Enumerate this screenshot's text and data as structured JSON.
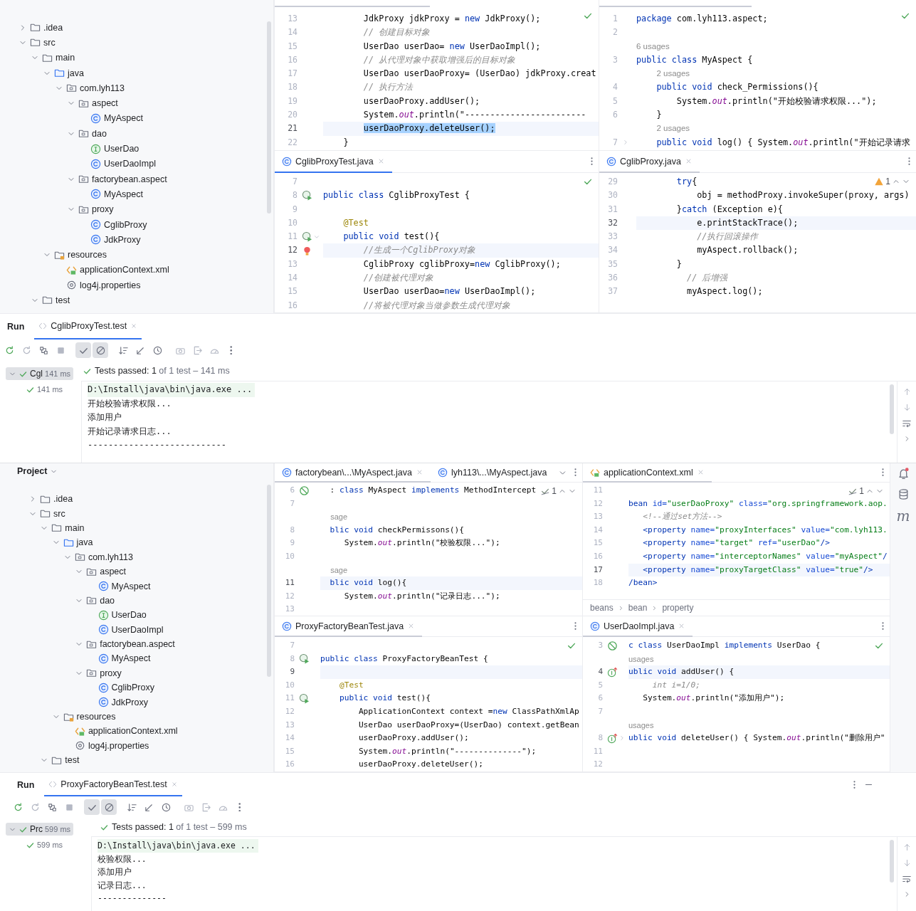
{
  "screens": [
    {
      "project": {
        "tree": [
          {
            "label": ".idea",
            "kind": "folder",
            "expanded": false
          },
          {
            "label": "src",
            "kind": "folder",
            "expanded": true,
            "children": [
              {
                "label": "main",
                "kind": "folder",
                "expanded": true,
                "children": [
                  {
                    "label": "java",
                    "kind": "source-folder",
                    "expanded": true,
                    "children": [
                      {
                        "label": "com.lyh113",
                        "kind": "package",
                        "expanded": true,
                        "children": [
                          {
                            "label": "aspect",
                            "kind": "package",
                            "expanded": true,
                            "children": [
                              {
                                "label": "MyAspect",
                                "kind": "class"
                              }
                            ]
                          },
                          {
                            "label": "dao",
                            "kind": "package",
                            "expanded": true,
                            "children": [
                              {
                                "label": "UserDao",
                                "kind": "interface"
                              },
                              {
                                "label": "UserDaoImpl",
                                "kind": "class"
                              }
                            ]
                          },
                          {
                            "label": "factorybean.aspect",
                            "kind": "package",
                            "expanded": true,
                            "children": [
                              {
                                "label": "MyAspect",
                                "kind": "class"
                              }
                            ]
                          },
                          {
                            "label": "proxy",
                            "kind": "package",
                            "expanded": true,
                            "children": [
                              {
                                "label": "CglibProxy",
                                "kind": "class"
                              },
                              {
                                "label": "JdkProxy",
                                "kind": "class"
                              }
                            ]
                          }
                        ]
                      }
                    ]
                  },
                  {
                    "label": "resources",
                    "kind": "resources",
                    "expanded": true,
                    "children": [
                      {
                        "label": "applicationContext.xml",
                        "kind": "xml"
                      },
                      {
                        "label": "log4j.properties",
                        "kind": "properties"
                      }
                    ]
                  }
                ]
              },
              {
                "label": "test",
                "kind": "folder",
                "expanded": true
              }
            ]
          }
        ]
      },
      "editors": [
        {
          "focused": false,
          "inspection": {
            "kind": "ok"
          },
          "lines": [
            {
              "number": "13",
              "kind": "code",
              "current": false,
              "parts": [
                {
                  "text": "        JdkProxy jdkProxy = ",
                  "kind": "plain"
                },
                {
                  "text": "new",
                  "kind": "kw"
                },
                {
                  "text": " JdkProxy();",
                  "kind": "plain"
                }
              ]
            },
            {
              "number": "14",
              "kind": "comment",
              "current": false,
              "text": "        // 创建目标对象"
            },
            {
              "number": "15",
              "kind": "code",
              "current": false,
              "parts": [
                {
                  "text": "        UserDao userDao= ",
                  "kind": "plain"
                },
                {
                  "text": "new",
                  "kind": "kw"
                },
                {
                  "text": " UserDaoImpl();",
                  "kind": "plain"
                }
              ]
            },
            {
              "number": "16",
              "kind": "comment",
              "current": false,
              "text": "        // 从代理对象中获取增强后的目标对象"
            },
            {
              "number": "17",
              "kind": "code",
              "current": false,
              "text": "        UserDao userDaoProxy= (UserDao) jdkProxy.creat"
            },
            {
              "number": "18",
              "kind": "comment",
              "current": false,
              "text": "        // 执行方法"
            },
            {
              "number": "19",
              "kind": "code",
              "current": false,
              "text": "        userDaoProxy.addUser();"
            },
            {
              "number": "20",
              "kind": "code",
              "current": false,
              "parts": [
                {
                  "text": "        System.",
                  "kind": "plain"
                },
                {
                  "text": "out",
                  "kind": "field"
                },
                {
                  "text": ".println(\"------------------------",
                  "kind": "plain"
                }
              ]
            },
            {
              "number": "21",
              "kind": "selected",
              "current": true,
              "text": "        userDaoProxy.deleteUser();"
            },
            {
              "number": "22",
              "kind": "code",
              "current": false,
              "text": "    }"
            }
          ]
        },
        {
          "focused": false,
          "inspection": {
            "kind": "ok"
          },
          "lines": [
            {
              "number": "1",
              "kind": "code",
              "current": false,
              "parts": [
                {
                  "text": "package",
                  "kind": "kw"
                },
                {
                  "text": " com.lyh113.aspect;",
                  "kind": "plain"
                }
              ]
            },
            {
              "number": "2",
              "kind": "code",
              "current": false
            },
            {
              "kind": "hint",
              "current": false,
              "text": "6 usages"
            },
            {
              "number": "3",
              "kind": "code",
              "current": false,
              "parts": [
                {
                  "text": "public class",
                  "kind": "kw"
                },
                {
                  "text": " MyAspect {",
                  "kind": "plain"
                }
              ]
            },
            {
              "kind": "hint",
              "current": false,
              "text": "    2 usages"
            },
            {
              "number": "4",
              "kind": "code",
              "current": false,
              "parts": [
                {
                  "text": "    public void",
                  "kind": "kw"
                },
                {
                  "text": " check_Permissions(){",
                  "kind": "plain"
                }
              ]
            },
            {
              "number": "5",
              "kind": "code",
              "current": false,
              "parts": [
                {
                  "text": "        System.",
                  "kind": "plain"
                },
                {
                  "text": "out",
                  "kind": "field"
                },
                {
                  "text": ".println(\"开始校验请求权限...\");",
                  "kind": "plain"
                }
              ]
            },
            {
              "number": "6",
              "kind": "code",
              "current": false,
              "text": "    }"
            },
            {
              "kind": "hint",
              "current": false,
              "text": "    2 usages"
            },
            {
              "number": "7",
              "kind": "code",
              "current": false,
              "folded": true,
              "parts": [
                {
                  "text": "    public void",
                  "kind": "kw"
                },
                {
                  "text": " log() { System.",
                  "kind": "plain"
                },
                {
                  "text": "out",
                  "kind": "field"
                },
                {
                  "text": ".println(\"开始记录请求",
                  "kind": "plain"
                }
              ]
            }
          ]
        },
        {
          "focused": true,
          "tabs": [
            {
              "label": "CglibProxyTest.java",
              "kind": "class",
              "selected": true,
              "closable": true
            }
          ],
          "inspection": {
            "kind": "ok"
          },
          "lines": [
            {
              "number": "7",
              "kind": "code",
              "current": false
            },
            {
              "number": "8",
              "kind": "code",
              "current": false,
              "marker": {
                "kind": "run"
              },
              "parts": [
                {
                  "text": "public class",
                  "kind": "kw"
                },
                {
                  "text": " CglibProxyTest {",
                  "kind": "plain"
                }
              ]
            },
            {
              "number": "9",
              "kind": "code",
              "current": false
            },
            {
              "number": "10",
              "kind": "annotation",
              "current": false,
              "text": "    @Test"
            },
            {
              "number": "11",
              "kind": "code",
              "current": false,
              "marker": {
                "kind": "run"
              },
              "folded": false,
              "parts": [
                {
                  "text": "    public void",
                  "kind": "kw"
                },
                {
                  "text": " test(){",
                  "kind": "plain"
                }
              ]
            },
            {
              "number": "12",
              "kind": "comment",
              "current": true,
              "marker": {
                "kind": "bulb"
              },
              "text": "        //生成一个CglibProxy对象"
            },
            {
              "number": "13",
              "kind": "code",
              "current": false,
              "parts": [
                {
                  "text": "        CglibProxy cglibProxy=",
                  "kind": "plain"
                },
                {
                  "text": "new",
                  "kind": "kw"
                },
                {
                  "text": " CglibProxy();",
                  "kind": "plain"
                }
              ]
            },
            {
              "number": "14",
              "kind": "comment",
              "current": false,
              "text": "        //创建被代理对象"
            },
            {
              "number": "15",
              "kind": "code",
              "current": false,
              "parts": [
                {
                  "text": "        UserDao userDao=",
                  "kind": "plain"
                },
                {
                  "text": "new",
                  "kind": "kw"
                },
                {
                  "text": " UserDaoImpl();",
                  "kind": "plain"
                }
              ]
            },
            {
              "number": "16",
              "kind": "comment",
              "current": false,
              "text": "        //将被代理对象当做参数生成代理对象"
            }
          ]
        },
        {
          "focused": false,
          "tabs": [
            {
              "label": "CglibProxy.java",
              "kind": "class",
              "selected": true,
              "closable": true
            }
          ],
          "inspection": {
            "kind": "warning",
            "count": "1"
          },
          "lines": [
            {
              "number": "29",
              "kind": "code",
              "current": false,
              "parts": [
                {
                  "text": "        try",
                  "kind": "kw"
                },
                {
                  "text": "{",
                  "kind": "plain"
                }
              ]
            },
            {
              "number": "30",
              "kind": "code",
              "current": false,
              "text": "            obj = methodProxy.invokeSuper(proxy, args)"
            },
            {
              "number": "31",
              "kind": "code",
              "current": false,
              "parts": [
                {
                  "text": "        }",
                  "kind": "plain"
                },
                {
                  "text": "catch",
                  "kind": "kw"
                },
                {
                  "text": " (Exception e){",
                  "kind": "plain"
                }
              ]
            },
            {
              "number": "32",
              "kind": "code",
              "current": true,
              "text": "            e.printStackTrace();"
            },
            {
              "number": "33",
              "kind": "comment",
              "current": false,
              "text": "            //执行回滚操作"
            },
            {
              "number": "34",
              "kind": "code",
              "current": false,
              "text": "            myAspect.rollback();"
            },
            {
              "number": "35",
              "kind": "code",
              "current": false,
              "text": "        }"
            },
            {
              "number": "36",
              "kind": "comment",
              "current": false,
              "text": "          // 后增强"
            },
            {
              "number": "37",
              "kind": "code",
              "current": false,
              "text": "          myAspect.log();"
            }
          ]
        }
      ],
      "run": {
        "title": "Run",
        "tabs": [
          {
            "label": "CglibProxyTest.test",
            "selected": true
          }
        ],
        "toolbar": [
          {
            "kind": "rerun",
            "on": false
          },
          {
            "kind": "rerun-failed",
            "on": false
          },
          {
            "kind": "toggle",
            "on": false
          },
          {
            "kind": "stop",
            "on": false
          },
          {
            "kind": "passed",
            "on": true
          },
          {
            "kind": "ignored",
            "on": true
          },
          {
            "kind": "sort",
            "on": false
          },
          {
            "kind": "collapse",
            "on": false
          },
          {
            "kind": "history",
            "on": false
          },
          {
            "kind": "screenshot",
            "on": false
          },
          {
            "kind": "export",
            "on": false
          },
          {
            "kind": "gauge",
            "on": false
          },
          {
            "kind": "more",
            "on": false
          }
        ],
        "tests": [
          {
            "label": "Cgl",
            "time": "141 ms",
            "passed": true,
            "selected": true,
            "expanded": true,
            "children": [
              {
                "time": "141 ms",
                "passed": true,
                "selected": false
              }
            ]
          }
        ],
        "status": {
          "passed": true,
          "summary": "Tests passed: 1",
          "detail": "of 1 test – 141 ms"
        },
        "console": [
          {
            "kind": "command",
            "text": "D:\\Install\\java\\bin\\java.exe ..."
          },
          {
            "kind": "output",
            "text": "开始校验请求权限..."
          },
          {
            "kind": "output",
            "text": "添加用户"
          },
          {
            "kind": "output",
            "text": "开始记录请求日志..."
          },
          {
            "kind": "output",
            "text": "---------------------------"
          }
        ]
      }
    },
    {
      "project": {
        "header": "Project",
        "tree": [
          {
            "label": ".idea",
            "kind": "folder",
            "expanded": false
          },
          {
            "label": "src",
            "kind": "folder",
            "expanded": true,
            "children": [
              {
                "label": "main",
                "kind": "folder",
                "expanded": true,
                "children": [
                  {
                    "label": "java",
                    "kind": "source-folder",
                    "expanded": true,
                    "children": [
                      {
                        "label": "com.lyh113",
                        "kind": "package",
                        "expanded": true,
                        "children": [
                          {
                            "label": "aspect",
                            "kind": "package",
                            "expanded": true,
                            "children": [
                              {
                                "label": "MyAspect",
                                "kind": "class"
                              }
                            ]
                          },
                          {
                            "label": "dao",
                            "kind": "package",
                            "expanded": true,
                            "children": [
                              {
                                "label": "UserDao",
                                "kind": "interface"
                              },
                              {
                                "label": "UserDaoImpl",
                                "kind": "class"
                              }
                            ]
                          },
                          {
                            "label": "factorybean.aspect",
                            "kind": "package",
                            "expanded": true,
                            "children": [
                              {
                                "label": "MyAspect",
                                "kind": "class"
                              }
                            ]
                          },
                          {
                            "label": "proxy",
                            "kind": "package",
                            "expanded": true,
                            "children": [
                              {
                                "label": "CglibProxy",
                                "kind": "class"
                              },
                              {
                                "label": "JdkProxy",
                                "kind": "class"
                              }
                            ]
                          }
                        ]
                      }
                    ]
                  },
                  {
                    "label": "resources",
                    "kind": "resources",
                    "expanded": true,
                    "children": [
                      {
                        "label": "applicationContext.xml",
                        "kind": "xml"
                      },
                      {
                        "label": "log4j.properties",
                        "kind": "properties"
                      }
                    ]
                  }
                ]
              },
              {
                "label": "test",
                "kind": "folder",
                "expanded": true
              }
            ]
          }
        ]
      },
      "editors": [
        {
          "focused": false,
          "tabs": [
            {
              "label": "factorybean\\...\\MyAspect.java",
              "kind": "class",
              "selected": true,
              "closable": true
            },
            {
              "label": "lyh113\\...\\MyAspect.java",
              "kind": "class",
              "selected": false,
              "closable": false
            }
          ],
          "tabs_overflow": true,
          "inspection": {
            "kind": "weak",
            "count": "1"
          },
          "lines": [
            {
              "number": "6",
              "kind": "code",
              "current": false,
              "marker": {
                "kind": "block"
              },
              "parts": [
                {
                  "text": "  : ",
                  "kind": "plain"
                },
                {
                  "text": "class",
                  "kind": "kw"
                },
                {
                  "text": " MyAspect ",
                  "kind": "plain"
                },
                {
                  "text": "implements",
                  "kind": "kw"
                },
                {
                  "text": " MethodIntercept",
                  "kind": "plain"
                }
              ]
            },
            {
              "number": "7",
              "kind": "code",
              "current": false
            },
            {
              "kind": "hint",
              "current": false,
              "text": "  sage"
            },
            {
              "number": "8",
              "kind": "code",
              "current": false,
              "parts": [
                {
                  "text": "  blic void",
                  "kind": "kw"
                },
                {
                  "text": " checkPermissons(){",
                  "kind": "plain"
                }
              ]
            },
            {
              "number": "9",
              "kind": "code",
              "current": false,
              "parts": [
                {
                  "text": "     System.",
                  "kind": "plain"
                },
                {
                  "text": "out",
                  "kind": "field"
                },
                {
                  "text": ".println(\"校验权限...\");",
                  "kind": "plain"
                }
              ]
            },
            {
              "number": "10",
              "kind": "code",
              "current": false
            },
            {
              "kind": "hint",
              "current": false,
              "text": "  sage"
            },
            {
              "number": "11",
              "kind": "code",
              "current": true,
              "parts": [
                {
                  "text": "  blic void",
                  "kind": "kw"
                },
                {
                  "text": " log(){",
                  "kind": "plain"
                }
              ]
            },
            {
              "number": "12",
              "kind": "code",
              "current": false,
              "parts": [
                {
                  "text": "     System.",
                  "kind": "plain"
                },
                {
                  "text": "out",
                  "kind": "field"
                },
                {
                  "text": ".println(\"记录日志...\");",
                  "kind": "plain"
                }
              ]
            },
            {
              "number": "13",
              "kind": "code",
              "current": false
            }
          ]
        },
        {
          "focused": false,
          "tabs": [
            {
              "label": "applicationContext.xml",
              "kind": "xml",
              "selected": true,
              "closable": true
            }
          ],
          "inspection": {
            "kind": "weak",
            "count": "1"
          },
          "breadcrumb": [
            "beans",
            "bean",
            "property"
          ],
          "lines": [
            {
              "number": "11",
              "kind": "code",
              "current": false
            },
            {
              "number": "12",
              "kind": "code",
              "current": false,
              "parts": [
                {
                  "text": "bean",
                  "kind": "tag"
                },
                {
                  "text": " id=",
                  "kind": "attr"
                },
                {
                  "text": "\"userDaoProxy\"",
                  "kind": "str"
                },
                {
                  "text": " class=",
                  "kind": "attr"
                },
                {
                  "text": "\"org.springframework.aop.",
                  "kind": "str"
                }
              ]
            },
            {
              "number": "13",
              "kind": "comment",
              "current": false,
              "text": "   <!--通过set方法-->"
            },
            {
              "number": "14",
              "kind": "code",
              "current": false,
              "parts": [
                {
                  "text": "   <property",
                  "kind": "tag"
                },
                {
                  "text": " name=",
                  "kind": "attr"
                },
                {
                  "text": "\"proxyInterfaces\"",
                  "kind": "str"
                },
                {
                  "text": " value=",
                  "kind": "attr"
                },
                {
                  "text": "\"com.lyh113.",
                  "kind": "str"
                }
              ]
            },
            {
              "number": "15",
              "kind": "code",
              "current": false,
              "parts": [
                {
                  "text": "   <property",
                  "kind": "tag"
                },
                {
                  "text": " name=",
                  "kind": "attr"
                },
                {
                  "text": "\"target\"",
                  "kind": "str"
                },
                {
                  "text": " ref=",
                  "kind": "attr"
                },
                {
                  "text": "\"userDao\"",
                  "kind": "str"
                },
                {
                  "text": "/>",
                  "kind": "tag"
                }
              ]
            },
            {
              "number": "16",
              "kind": "code",
              "current": false,
              "parts": [
                {
                  "text": "   <property",
                  "kind": "tag"
                },
                {
                  "text": " name=",
                  "kind": "attr"
                },
                {
                  "text": "\"interceptorNames\"",
                  "kind": "str"
                },
                {
                  "text": " value=",
                  "kind": "attr"
                },
                {
                  "text": "\"myAspect\"",
                  "kind": "str"
                },
                {
                  "text": "/",
                  "kind": "tag"
                }
              ]
            },
            {
              "number": "17",
              "kind": "code",
              "current": true,
              "parts": [
                {
                  "text": "   <property",
                  "kind": "tag"
                },
                {
                  "text": " name=",
                  "kind": "attr"
                },
                {
                  "text": "\"proxyTargetClass\"",
                  "kind": "str"
                },
                {
                  "text": " value=",
                  "kind": "attr"
                },
                {
                  "text": "\"true\"",
                  "kind": "str"
                },
                {
                  "text": "/>",
                  "kind": "tag"
                }
              ]
            },
            {
              "number": "18",
              "kind": "code",
              "current": false,
              "parts": [
                {
                  "text": "/bean>",
                  "kind": "tag"
                }
              ]
            }
          ]
        },
        {
          "focused": false,
          "tabs": [
            {
              "label": "ProxyFactoryBeanTest.java",
              "kind": "class",
              "selected": true,
              "closable": true
            }
          ],
          "inspection": {
            "kind": "ok"
          },
          "lines": [
            {
              "number": "7",
              "kind": "code",
              "current": false
            },
            {
              "number": "8",
              "kind": "code",
              "current": false,
              "marker": {
                "kind": "run"
              },
              "parts": [
                {
                  "text": "public class",
                  "kind": "kw"
                },
                {
                  "text": " ProxyFactoryBeanTest {",
                  "kind": "plain"
                }
              ]
            },
            {
              "number": "9",
              "kind": "code",
              "current": true
            },
            {
              "number": "10",
              "kind": "annotation",
              "current": false,
              "text": "    @Test"
            },
            {
              "number": "11",
              "kind": "code",
              "current": false,
              "marker": {
                "kind": "run"
              },
              "parts": [
                {
                  "text": "    public void",
                  "kind": "kw"
                },
                {
                  "text": " test(){",
                  "kind": "plain"
                }
              ]
            },
            {
              "number": "12",
              "kind": "code",
              "current": false,
              "parts": [
                {
                  "text": "        ApplicationContext context =",
                  "kind": "plain"
                },
                {
                  "text": "new",
                  "kind": "kw"
                },
                {
                  "text": " ClassPathXmlAp",
                  "kind": "plain"
                }
              ]
            },
            {
              "number": "13",
              "kind": "code",
              "current": false,
              "text": "        UserDao userDaoProxy=(UserDao) context.getBean"
            },
            {
              "number": "14",
              "kind": "code",
              "current": false,
              "text": "        userDaoProxy.addUser();"
            },
            {
              "number": "15",
              "kind": "code",
              "current": false,
              "parts": [
                {
                  "text": "        System.",
                  "kind": "plain"
                },
                {
                  "text": "out",
                  "kind": "field"
                },
                {
                  "text": ".println(\"--------------\");",
                  "kind": "plain"
                }
              ]
            },
            {
              "number": "16",
              "kind": "code",
              "current": false,
              "text": "        userDaoProxy.deleteUser();"
            }
          ]
        },
        {
          "focused": false,
          "tabs": [
            {
              "label": "UserDaoImpl.java",
              "kind": "class",
              "selected": true,
              "closable": true
            }
          ],
          "inspection": {
            "kind": "ok"
          },
          "lines": [
            {
              "number": "3",
              "kind": "code",
              "current": false,
              "marker": {
                "kind": "block"
              },
              "parts": [
                {
                  "text": "c class",
                  "kind": "kw"
                },
                {
                  "text": " UserDaoImpl ",
                  "kind": "plain"
                },
                {
                  "text": "implements",
                  "kind": "kw"
                },
                {
                  "text": " UserDao {",
                  "kind": "plain"
                }
              ]
            },
            {
              "kind": "hint",
              "current": false,
              "text": "usages"
            },
            {
              "number": "4",
              "kind": "code",
              "current": true,
              "marker": {
                "kind": "impl"
              },
              "parts": [
                {
                  "text": "ublic void",
                  "kind": "kw"
                },
                {
                  "text": " addUser() {",
                  "kind": "plain"
                }
              ]
            },
            {
              "number": "5",
              "kind": "comment",
              "current": false,
              "text": "     int i=1/0;"
            },
            {
              "number": "6",
              "kind": "code",
              "current": false,
              "parts": [
                {
                  "text": "   System.",
                  "kind": "plain"
                },
                {
                  "text": "out",
                  "kind": "field"
                },
                {
                  "text": ".println(\"添加用户\");",
                  "kind": "plain"
                }
              ]
            },
            {
              "number": "7",
              "kind": "code",
              "current": false
            },
            {
              "kind": "hint",
              "current": false,
              "text": "usages"
            },
            {
              "number": "8",
              "kind": "code",
              "current": false,
              "marker": {
                "kind": "impl"
              },
              "folded": true,
              "parts": [
                {
                  "text": "ublic void",
                  "kind": "kw"
                },
                {
                  "text": " deleteUser() { System.",
                  "kind": "plain"
                },
                {
                  "text": "out",
                  "kind": "field"
                },
                {
                  "text": ".println(\"删除用户\"",
                  "kind": "plain"
                }
              ]
            },
            {
              "number": "11",
              "kind": "code",
              "current": false
            },
            {
              "number": "12",
              "kind": "code",
              "current": false
            }
          ]
        }
      ],
      "tool_strip": [
        {
          "kind": "bell"
        },
        {
          "kind": "database"
        },
        {
          "kind": "glyph",
          "glyph": "m"
        }
      ],
      "run": {
        "title": "Run",
        "tabs": [
          {
            "label": "ProxyFactoryBeanTest.test",
            "selected": true
          }
        ],
        "header_actions": [
          {
            "kind": "more"
          },
          {
            "kind": "minimize"
          }
        ],
        "toolbar": [
          {
            "kind": "rerun",
            "on": false
          },
          {
            "kind": "rerun-failed",
            "on": false
          },
          {
            "kind": "toggle",
            "on": false
          },
          {
            "kind": "stop",
            "on": false
          },
          {
            "kind": "passed",
            "on": true
          },
          {
            "kind": "ignored",
            "on": true
          },
          {
            "kind": "sort",
            "on": false
          },
          {
            "kind": "collapse",
            "on": false
          },
          {
            "kind": "history",
            "on": false
          },
          {
            "kind": "screenshot",
            "on": false
          },
          {
            "kind": "export",
            "on": false
          },
          {
            "kind": "gauge",
            "on": false
          },
          {
            "kind": "more",
            "on": false
          }
        ],
        "tests": [
          {
            "label": "Prc",
            "time": "599 ms",
            "passed": true,
            "selected": true,
            "expanded": true,
            "children": [
              {
                "time": "599 ms",
                "passed": true,
                "selected": false
              }
            ]
          }
        ],
        "status": {
          "passed": true,
          "summary": "Tests passed: 1",
          "detail": "of 1 test – 599 ms"
        },
        "console": [
          {
            "kind": "command",
            "text": "D:\\Install\\java\\bin\\java.exe ..."
          },
          {
            "kind": "output",
            "text": "校验权限..."
          },
          {
            "kind": "output",
            "text": "添加用户"
          },
          {
            "kind": "output",
            "text": "记录日志..."
          },
          {
            "kind": "output",
            "text": "--------------"
          }
        ]
      }
    }
  ]
}
